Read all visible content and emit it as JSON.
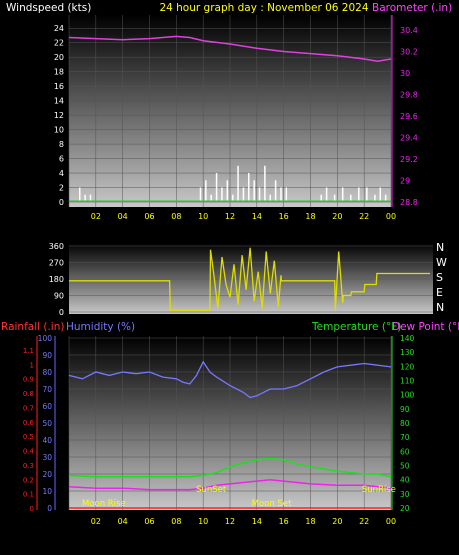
{
  "header": {
    "left_title": "Windspeed (kts)",
    "center_title": "24 hour graph day : November 06 2024",
    "right_title": "Barometer (.in)"
  },
  "colors": {
    "background": "#000000",
    "wind": "#ffffff",
    "gust_green": "#22cc22",
    "barometer": "#e040e0",
    "direction": "#dddd00",
    "humidity": "#7777ff",
    "temperature": "#22dd22",
    "dew_point": "#ee22ee",
    "rainfall": "#ff2222",
    "time_labels": "#ffff00",
    "left_axis": "#ffffff",
    "baro_axis": "#ee22ee"
  },
  "chart_data": [
    {
      "type": "line",
      "title": "24 hour graph day : November 06 2024",
      "xlabel": "",
      "ylabel": "Windspeed (kts)",
      "y2label": "Barometer (.in)",
      "x_ticks": [
        "02",
        "04",
        "06",
        "08",
        "10",
        "12",
        "14",
        "16",
        "18",
        "20",
        "22",
        "00"
      ],
      "ylim": [
        0,
        25
      ],
      "y_ticks": [
        "0",
        "2",
        "4",
        "6",
        "8",
        "10",
        "12",
        "14",
        "16",
        "18",
        "20",
        "22",
        "24"
      ],
      "y2lim": [
        28.8,
        30.4
      ],
      "y2_ticks": [
        "28.8",
        "29",
        "29.2",
        "29.4",
        "29.6",
        "29.8",
        "30",
        "30.2",
        "30.4"
      ],
      "series": [
        {
          "name": "",
          "axis": "right",
          "x": [
            0,
            2,
            4,
            6,
            8,
            9,
            10,
            12,
            14,
            16,
            18,
            20,
            22,
            23,
            24
          ],
          "values": [
            30.33,
            30.32,
            30.31,
            30.32,
            30.34,
            30.33,
            30.3,
            30.27,
            30.23,
            30.2,
            30.18,
            30.16,
            30.13,
            30.11,
            30.13
          ]
        },
        {
          "name": "",
          "axis": "left",
          "x": [
            0.8,
            1.2,
            1.6,
            9.8,
            10.2,
            10.6,
            11.0,
            11.4,
            11.8,
            12.2,
            12.6,
            13.0,
            13.4,
            13.8,
            14.2,
            14.6,
            15.0,
            15.4,
            15.8,
            16.2,
            18.8,
            19.2,
            19.8,
            20.4,
            21.0,
            21.6,
            22.2,
            22.8,
            23.2,
            23.6
          ],
          "values": [
            2,
            1,
            1,
            2,
            3,
            1,
            4,
            2,
            3,
            1,
            5,
            2,
            4,
            3,
            2,
            5,
            1,
            3,
            2,
            2,
            1,
            2,
            1,
            2,
            1,
            2,
            2,
            1,
            2,
            1
          ]
        }
      ]
    },
    {
      "type": "line",
      "xlabel": "",
      "ylabel": "",
      "ylim": [
        0,
        360
      ],
      "y_ticks": [
        "0",
        "90",
        "180",
        "270",
        "360"
      ],
      "dir_labels": [
        "N",
        "W",
        "S",
        "E",
        "N"
      ],
      "series": [
        {
          "name": "",
          "x": [
            0,
            7.5,
            7.55,
            10.5,
            10.55,
            10.8,
            11.1,
            11.4,
            11.7,
            12.0,
            12.3,
            12.6,
            12.9,
            13.2,
            13.5,
            13.8,
            14.1,
            14.4,
            14.7,
            15.0,
            15.3,
            15.6,
            15.8,
            15.82,
            19.8,
            19.85,
            20.1,
            20.4,
            20.45,
            21.0,
            21.05,
            22.0,
            22.05,
            22.9,
            22.95,
            24
          ],
          "values": [
            170,
            170,
            10,
            10,
            340,
            200,
            20,
            300,
            150,
            80,
            260,
            40,
            310,
            120,
            350,
            60,
            220,
            20,
            330,
            100,
            280,
            30,
            200,
            170,
            170,
            10,
            330,
            50,
            90,
            90,
            110,
            110,
            150,
            150,
            210,
            210
          ]
        }
      ]
    },
    {
      "type": "line",
      "xlabel": "",
      "ylabel": "Humidity (%)",
      "y_left2label": "Rainfall (.in)",
      "y2label": "Temperature (°F)",
      "y3label": "Dew Point (°F)",
      "ylim": [
        0,
        100
      ],
      "y_ticks": [
        "0",
        "10",
        "20",
        "30",
        "40",
        "50",
        "60",
        "70",
        "80",
        "90",
        "100"
      ],
      "rain_ticks": [
        "0",
        "0.1",
        "0.2",
        "0.3",
        "0.4",
        "0.5",
        "0.6",
        "0.7",
        "0.8",
        "0.9",
        "1",
        "1.1"
      ],
      "temp_lim": [
        20,
        140
      ],
      "temp_ticks": [
        "20",
        "30",
        "40",
        "50",
        "60",
        "70",
        "80",
        "90",
        "100",
        "110",
        "120",
        "130",
        "140"
      ],
      "events": [
        {
          "label": "Moon Rise",
          "x": 2.0,
          "row": "bottom"
        },
        {
          "label": "SunSet",
          "x": 10.0,
          "row": "mid"
        },
        {
          "label": "Moon Set",
          "x": 14.5,
          "row": "bottom"
        },
        {
          "label": "SunRise",
          "x": 22.5,
          "row": "mid"
        }
      ],
      "series": [
        {
          "name": "",
          "axis": "humidity",
          "x": [
            0,
            1,
            2,
            3,
            4,
            5,
            6,
            7,
            8,
            8.5,
            9,
            9.5,
            10,
            10.5,
            11,
            12,
            13,
            13.5,
            14,
            14.5,
            15,
            16,
            17,
            18,
            19,
            20,
            21,
            22,
            23,
            24
          ],
          "values": [
            78,
            76,
            80,
            78,
            80,
            79,
            80,
            77,
            76,
            74,
            73,
            78,
            86,
            80,
            77,
            72,
            68,
            65,
            66,
            68,
            70,
            70,
            72,
            76,
            80,
            83,
            84,
            85,
            84,
            83
          ]
        },
        {
          "name": "",
          "axis": "temp",
          "x": [
            0,
            2,
            4,
            6,
            8,
            9,
            10,
            11,
            12,
            13,
            14,
            15,
            16,
            17,
            18,
            20,
            22,
            23,
            24
          ],
          "values": [
            43,
            42,
            42,
            42,
            42,
            42,
            43,
            45,
            49,
            52,
            54,
            55,
            54,
            51,
            49,
            46,
            44,
            44,
            42
          ]
        },
        {
          "name": "",
          "axis": "temp",
          "x": [
            0,
            2,
            4,
            6,
            8,
            9,
            10,
            11,
            12,
            13,
            14,
            15,
            16,
            17,
            18,
            20,
            22,
            23,
            24
          ],
          "values": [
            35,
            34,
            34,
            33,
            33,
            33,
            34,
            36,
            37,
            38,
            39,
            40,
            39,
            38,
            37,
            36,
            36,
            35,
            34
          ]
        },
        {
          "name": "",
          "axis": "rain",
          "x": [
            0,
            24
          ],
          "values": [
            0,
            0
          ]
        }
      ]
    }
  ]
}
